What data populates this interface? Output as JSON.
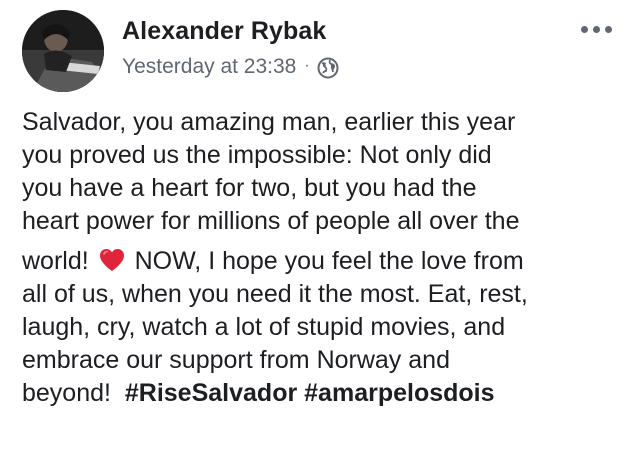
{
  "post": {
    "author": "Alexander Rybak",
    "timestamp": "Yesterday at 23:38",
    "separator": "·",
    "privacy_icon": "globe-icon",
    "more_icon": "more-options-icon",
    "avatar_icon": "profile-photo",
    "lines": [
      "Salvador, you amazing man, earlier this year",
      "you proved us the impossible: Not only did",
      "you have a heart for two, but you had the",
      "heart power for millions of people all over the"
    ],
    "line5_before": "world!",
    "line5_after": "NOW, I hope you feel the love from",
    "emoji": "red-heart",
    "lines_after": [
      "all of us, when you need it the most. Eat, rest,",
      "laugh, cry, watch a lot of stupid movies, and",
      "embrace our support from Norway and"
    ],
    "last_line_text": "beyond!",
    "hashtags": [
      "#RiseSalvador",
      "#amarpelosdois"
    ]
  },
  "colors": {
    "text": "#1c1e21",
    "meta": "#606770",
    "heart": "#e0243a"
  }
}
